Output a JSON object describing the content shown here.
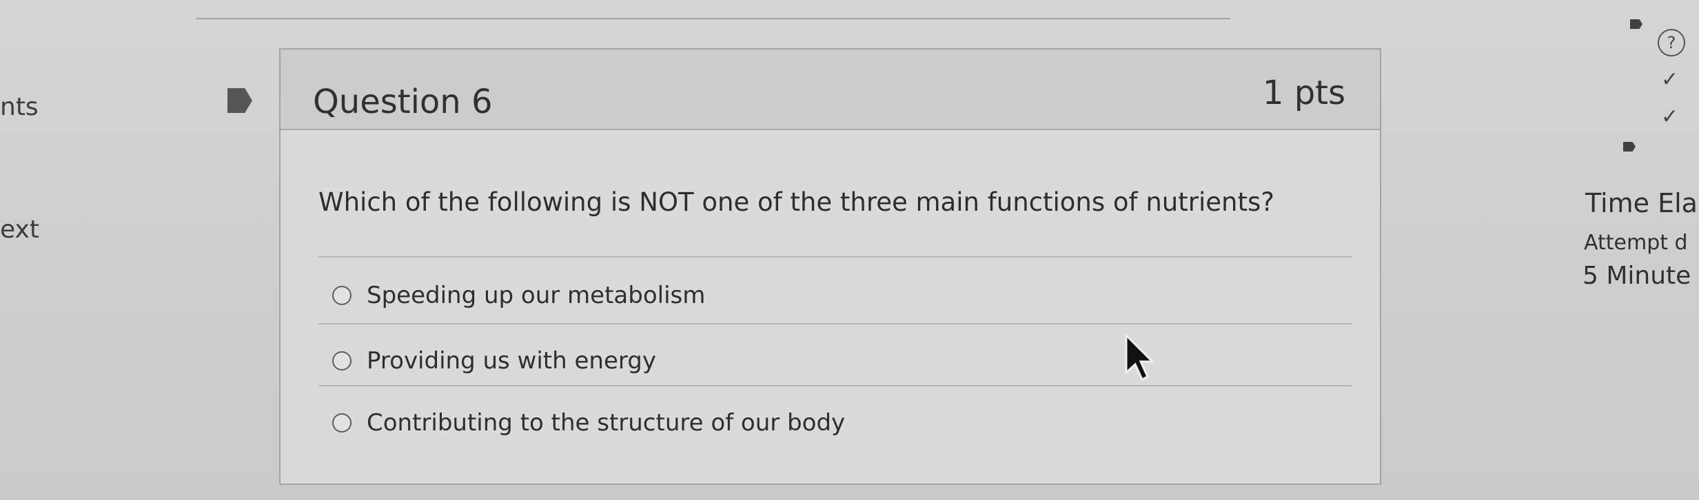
{
  "left_fragments": {
    "pts": "nts",
    "next": "ext"
  },
  "question": {
    "title": "Question 6",
    "points": "1 pts",
    "text": "Which of the following is NOT one of the three main functions of nutrients?",
    "answers": [
      "Speeding up our metabolism",
      "Providing us with energy",
      "Contributing to the structure of our body"
    ]
  },
  "right_panel": {
    "help_symbol": "?",
    "time_label": "Time Ela",
    "attempt_label": "Attempt d",
    "minutes_label": "5 Minute"
  }
}
